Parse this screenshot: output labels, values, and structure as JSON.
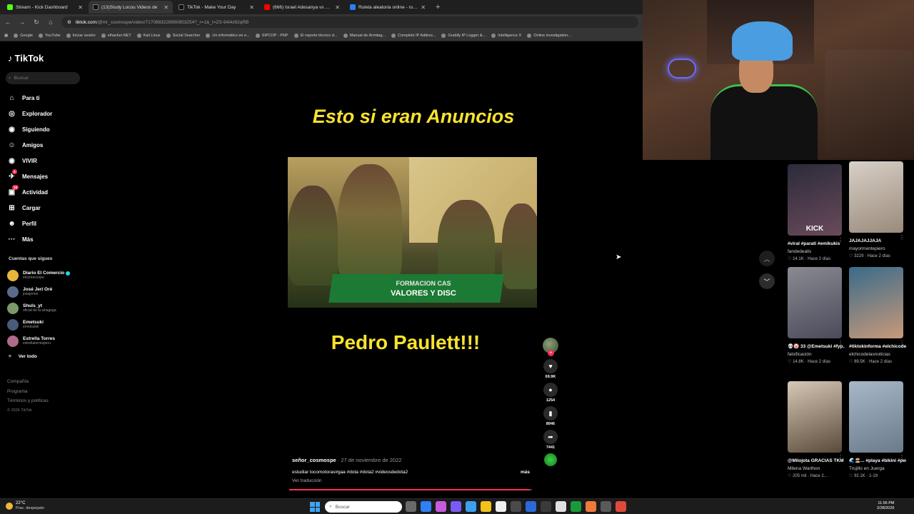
{
  "browser": {
    "tabs": [
      {
        "label": "Stream - Kick Dashboard",
        "color": "#53fc18"
      },
      {
        "label": "(13)Study Locou Videos de",
        "color": "#111111",
        "active": true
      },
      {
        "label": "TikTok - Make Your Day",
        "color": "#111111"
      },
      {
        "label": "(666) Israel Adesanya vs Alex P",
        "color": "#ff0000"
      },
      {
        "label": "Ruleta aleatoria online - ruleta",
        "color": "#2d7ff9"
      }
    ],
    "new_tab": "+",
    "url_host": "tiktok.com",
    "url_path": "/@mr_cosmospe/video/7170883228960853254?_r=1&_t=ZS-94i4z62qRB",
    "bookmarks": [
      "Google",
      "YouTube",
      "Iniciar sesión",
      "elhacker.NET",
      "Kali Linux",
      "Social Searcher",
      "Un informático en e...",
      "SIPCOP - PNP",
      "El reporte técnico d...",
      "Manual de Armitag...",
      "Complete IP Addres...",
      "Grabify IP Logger &...",
      "Intelligence X",
      "Online investigation..."
    ]
  },
  "tiktok": {
    "logo": "TikTok",
    "search_placeholder": "Buscar",
    "nav": [
      {
        "label": "Para ti",
        "icon": "home-icon"
      },
      {
        "label": "Explorador",
        "icon": "compass-icon"
      },
      {
        "label": "Siguiendo",
        "icon": "following-icon"
      },
      {
        "label": "Amigos",
        "icon": "friends-icon"
      },
      {
        "label": "VIVIR",
        "icon": "live-icon"
      },
      {
        "label": "Mensajes",
        "icon": "messages-icon",
        "badge": "4"
      },
      {
        "label": "Actividad",
        "icon": "activity-icon",
        "badge": "19"
      },
      {
        "label": "Cargar",
        "icon": "upload-icon"
      },
      {
        "label": "Perfil",
        "icon": "profile-icon"
      },
      {
        "label": "Más",
        "icon": "more-icon"
      }
    ],
    "following_header": "Cuentas que sigues",
    "following": [
      {
        "name": "Diario El Comercio",
        "handle": "elcomerciope",
        "verified": true,
        "color": "#e5b53c"
      },
      {
        "name": "José Jerí Oré",
        "handle": "josejerioe",
        "verified": false,
        "color": "#5a6a8a"
      },
      {
        "name": "Shuls_yt",
        "handle": "oficial de la sinagoga",
        "verified": false,
        "color": "#7a9a6a"
      },
      {
        "name": "Emetsuki",
        "handle": "emetsukiii",
        "verified": false,
        "color": "#4a5a7a"
      },
      {
        "name": "Estrella Torres",
        "handle": "estrellatorresperu",
        "verified": false,
        "color": "#b06a8a"
      }
    ],
    "see_all": "Ver todo",
    "footer": [
      "Compañía",
      "Programa",
      "Términos y políticas"
    ],
    "copyright": "© 2026 TikTok"
  },
  "video": {
    "title": "Esto si eran Anuncios",
    "banner_line1": "FORMACION CAS",
    "banner_line2": "VALORES Y DISC",
    "subtitle": "Pedro Paulett!!!",
    "author": "señor_cosmospe",
    "date": " · 27 de noviembre de 2022",
    "description": "estudiar locomotoras#gaa #dota #dota2 #videosdedota2",
    "more": "más",
    "translate": "Ver traducción",
    "progress": 0.99,
    "likes": "69.9K",
    "comments": "1254",
    "saves": "8946",
    "shares": "7441"
  },
  "related": [
    {
      "title": "#viral #parati #emikukis",
      "author": "fandedealis",
      "likes": "14.1K",
      "age": "Hace 2 días",
      "colors": [
        "#2b2b3a",
        "#6a4a5a"
      ],
      "caption": "KICK"
    },
    {
      "title": "JAJAJAJJAJA",
      "author": "mayormentepiero",
      "likes": "3229",
      "age": "Hace 2 días",
      "colors": [
        "#d8d0c8",
        "#9a8a7a"
      ],
      "caption": ""
    },
    {
      "title": "💀🤡 33 @Emetsuki #fyp...",
      "author": "falsificación",
      "likes": "14.8K",
      "age": "Hace 2 días",
      "colors": [
        "#8a8a92",
        "#4a4a5a"
      ],
      "caption": ""
    },
    {
      "title": "#tiktokinforma #elchicodelasnot...",
      "author": "elchicodelasnoticias",
      "likes": "89.5K",
      "age": "Hace 2 días",
      "colors": [
        "#3a6a8a",
        "#c89a7a"
      ],
      "caption": ""
    },
    {
      "title": "@Milojota GRACIAS TKM",
      "author": "Milena Warthon",
      "likes": "205 mil",
      "age": "Hace 2...",
      "colors": [
        "#d8c8b8",
        "#5a4a3a"
      ],
      "caption": ""
    },
    {
      "title": "🌊🏖️... #playa #bikini #perú",
      "author": "Trujillo en Juerga",
      "likes": "92.1K",
      "age": "1-19",
      "colors": [
        "#a8b8c8",
        "#6a7a8a"
      ],
      "caption": ""
    }
  ],
  "taskbar": {
    "temp": "22°C",
    "condition": "Prac. despejado",
    "search": "Buscar",
    "time": "11:56 PM",
    "date": "2/28/2026",
    "apps": [
      "#6a6a6a",
      "#2f7ff5",
      "#c85ae0",
      "#7a5af5",
      "#3aa0f0",
      "#f2c21b",
      "#f0f0f0",
      "#4a4a4a",
      "#2a6ad8",
      "#3a3a3a",
      "#e0e0e0",
      "#1a9a3a",
      "#f07a3a",
      "#5a5a5a",
      "#e04a3a"
    ]
  }
}
